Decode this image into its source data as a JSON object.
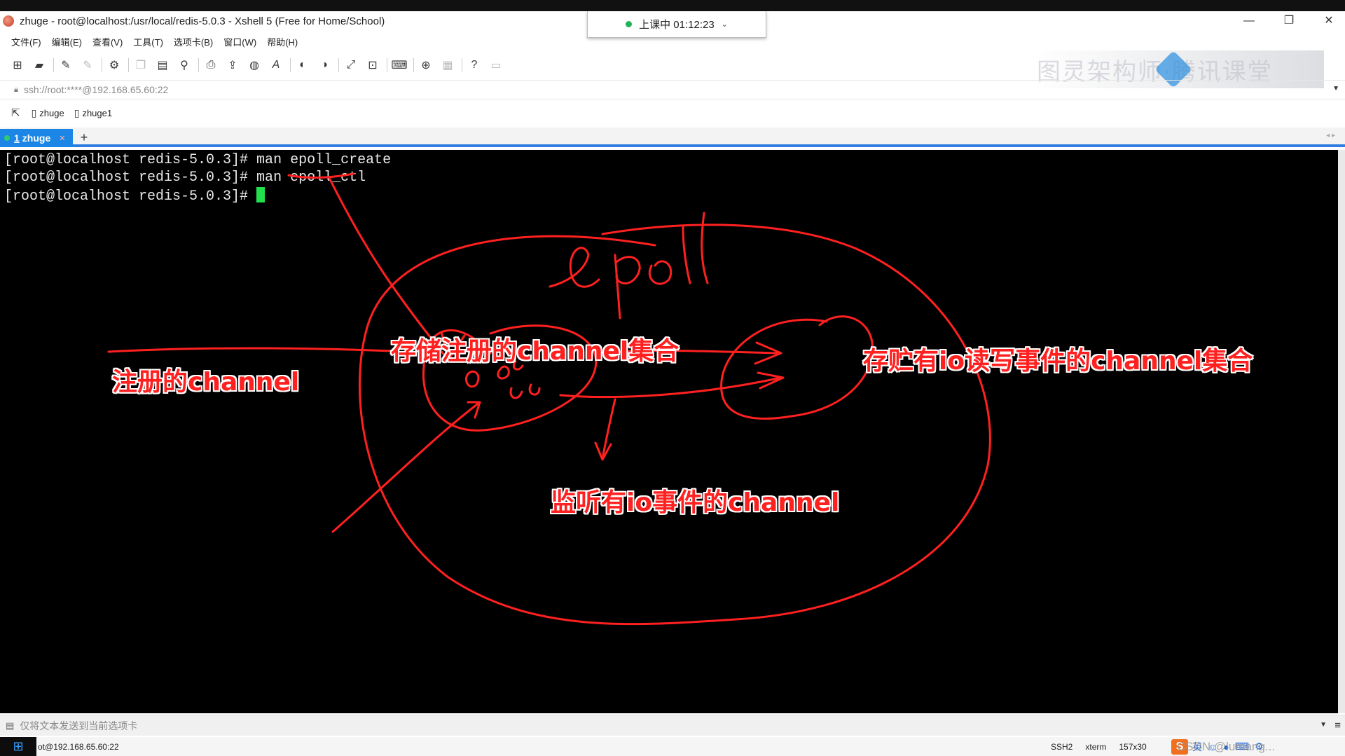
{
  "window": {
    "title": "zhuge - root@localhost:/usr/local/redis-5.0.3 - Xshell 5 (Free for Home/School)",
    "controls": {
      "minimize": "—",
      "restore": "❐",
      "close": "✕"
    }
  },
  "timer": {
    "label": "上课中 01:12:23"
  },
  "menubar": {
    "items": [
      "文件(F)",
      "编辑(E)",
      "查看(V)",
      "工具(T)",
      "选项卡(B)",
      "窗口(W)",
      "帮助(H)"
    ]
  },
  "toolbar": {
    "icons": [
      "new-session",
      "open",
      "reconnect",
      "disconnect",
      "properties",
      "copy",
      "paste",
      "find",
      "print",
      "transfer",
      "globe",
      "font",
      "sftp",
      "xftp",
      "fullscreen",
      "lock",
      "keyboard",
      "add",
      "layout",
      "help",
      "chat"
    ]
  },
  "watermark": {
    "text": "图灵架构师·腾讯课堂"
  },
  "addressbar": {
    "address": "ssh://root:****@192.168.65.60:22"
  },
  "linksbar": {
    "items": [
      {
        "label": "zhuge"
      },
      {
        "label": "zhuge1"
      }
    ]
  },
  "tabs": {
    "active": {
      "number": "1",
      "label": "zhuge"
    },
    "add": "+"
  },
  "terminal": {
    "lines": [
      "[root@localhost redis-5.0.3]# man epoll_create",
      "[root@localhost redis-5.0.3]# man epoll_ctl",
      "[root@localhost redis-5.0.3]# "
    ]
  },
  "annotations": {
    "handwriting": "epoll",
    "registered_set": "存储注册的channel集合",
    "registered_channel": "注册的channel",
    "ready_set": "存贮有io读写事件的channel集合",
    "listen": "监听有io事件的channel",
    "ink_color": "#ff2020"
  },
  "composebar": {
    "placeholder": "仅将文本发送到当前选项卡"
  },
  "statusbar": {
    "host": "ot@192.168.65.60:22",
    "protocol": "SSH2",
    "terminal_type": "xterm",
    "size": "157x30",
    "tray_ime": "英",
    "tray_watermark": "CSDN @lumang..."
  }
}
